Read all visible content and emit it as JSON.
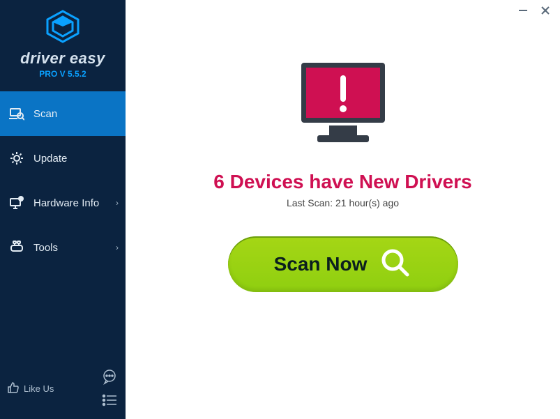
{
  "brand": {
    "name": "driver easy",
    "tier": "PRO",
    "version": "V 5.5.2"
  },
  "sidebar": {
    "items": [
      {
        "label": "Scan",
        "has_chevron": false
      },
      {
        "label": "Update",
        "has_chevron": false
      },
      {
        "label": "Hardware Info",
        "has_chevron": true
      },
      {
        "label": "Tools",
        "has_chevron": true
      }
    ],
    "footer": {
      "like_label": "Like Us"
    }
  },
  "main": {
    "headline": "6 Devices have New Drivers",
    "last_scan": "Last Scan: 21 hour(s) ago",
    "scan_button_label": "Scan Now"
  },
  "colors": {
    "accent_pink": "#cf1052",
    "scan_green": "#9ed312",
    "sidebar_bg": "#0b2340",
    "active_blue": "#0a74c5",
    "brand_blue": "#0aa1ff"
  }
}
